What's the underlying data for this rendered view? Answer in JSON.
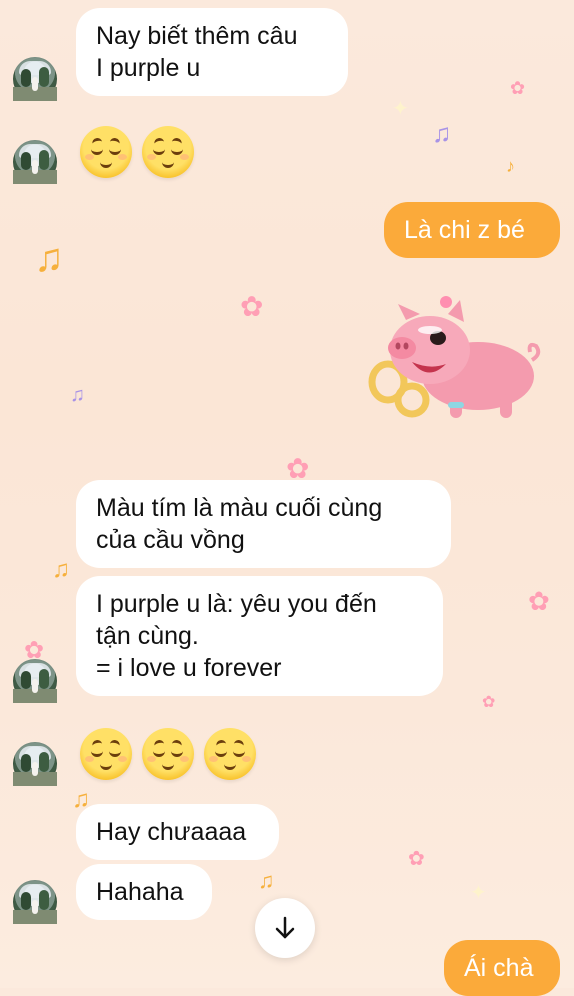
{
  "messages": {
    "m1": {
      "lines": [
        "Nay biết thêm câu",
        "I purple u"
      ]
    },
    "m2": {
      "emojis": [
        "relieved-face",
        "relieved-face"
      ]
    },
    "m3": {
      "text": "Là chi z bé"
    },
    "m4": {
      "sticker": "pink-pig-sticker"
    },
    "m5": {
      "lines": [
        "Màu tím là màu cuối cùng",
        "của cầu vồng"
      ]
    },
    "m6": {
      "lines": [
        "I purple u là: yêu you đến",
        "tận cùng.",
        "= i love u forever"
      ]
    },
    "m7": {
      "emojis": [
        "relieved-face",
        "relieved-face",
        "relieved-face"
      ]
    },
    "m8": {
      "text": "Hay chưaaaa"
    },
    "m9": {
      "text": "Hahaha"
    },
    "m10": {
      "text": "Ái chà"
    }
  },
  "scroll_button": {
    "icon": "arrow-down-icon"
  },
  "colors": {
    "outgoing_bubble": "#fbaa3a",
    "incoming_bubble": "#ffffff",
    "background": "#fbe8da"
  }
}
